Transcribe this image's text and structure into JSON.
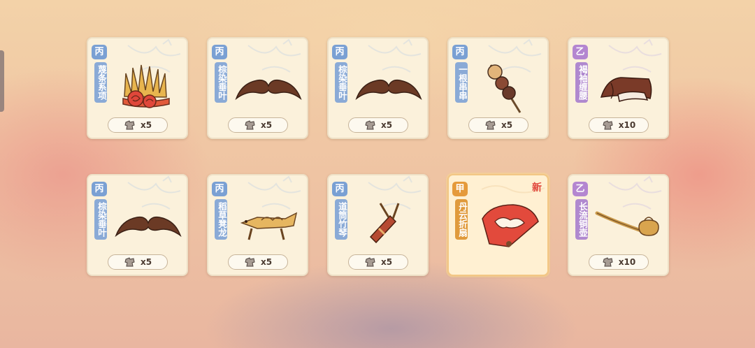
{
  "cards": [
    {
      "grade": "丙",
      "name": "蔑条系项",
      "cost": "x5",
      "icon": "crown-bamboo-icon"
    },
    {
      "grade": "丙",
      "name": "棕染垂叶",
      "cost": "x5",
      "icon": "mustache-icon"
    },
    {
      "grade": "丙",
      "name": "棕染垂叶",
      "cost": "x5",
      "icon": "mustache-icon"
    },
    {
      "grade": "丙",
      "name": "一根串串",
      "cost": "x5",
      "icon": "skewer-icon"
    },
    {
      "grade": "乙",
      "name": "褐袖缠腰",
      "cost": "x10",
      "icon": "sash-icon"
    },
    {
      "grade": "丙",
      "name": "棕染垂叶",
      "cost": "x5",
      "icon": "mustache-icon"
    },
    {
      "grade": "丙",
      "name": "稻草凳龙",
      "cost": "x5",
      "icon": "straw-dragon-icon"
    },
    {
      "grade": "丙",
      "name": "道筒竹琴",
      "cost": "x5",
      "icon": "bamboo-tube-icon"
    },
    {
      "grade": "甲",
      "name": "丹云折扇",
      "new_label": "新",
      "icon": "folding-fan-icon"
    },
    {
      "grade": "乙",
      "name": "长流铜壶",
      "cost": "x10",
      "icon": "copper-teapot-icon"
    }
  ],
  "colors": {
    "bing": "#7aa0d3",
    "yi": "#b486d0",
    "jia": "#e59a3b",
    "new": "#e0443a"
  },
  "currency_icon": "cloth-currency-icon"
}
